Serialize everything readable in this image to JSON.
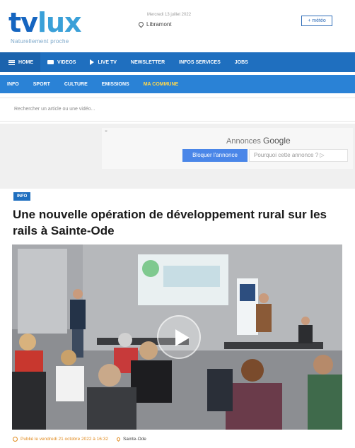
{
  "header": {
    "logo_tv": "tv",
    "logo_lux": "lux",
    "tagline": "Naturellement proche",
    "date": "Mercredi 13 juillet 2022",
    "location": "Libramont",
    "meteo_button": "+ météo"
  },
  "nav_primary": {
    "items": [
      {
        "label": "HOME",
        "icon": "menu-icon"
      },
      {
        "label": "VIDEOS",
        "icon": "video-icon"
      },
      {
        "label": "LIVE TV",
        "icon": "play-icon"
      },
      {
        "label": "NEWSLETTER"
      },
      {
        "label": "INFOS SERVICES"
      },
      {
        "label": "JOBS"
      }
    ]
  },
  "nav_secondary": {
    "items": [
      "INFO",
      "SPORT",
      "CULTURE",
      "EMISSIONS",
      "MA COMMUNE"
    ],
    "active_index": 4
  },
  "search": {
    "placeholder": "Rechercher un article ou une vidéo..."
  },
  "ad": {
    "close": "×",
    "title_prefix": "Annonces ",
    "title_brand": "Google",
    "block_button": "Bloquer l'annonce",
    "why_button": "Pourquoi cette annonce ? ▷"
  },
  "article": {
    "category": "INFO",
    "title": "Une nouvelle opération de développement rural sur les rails à Sainte-Ode",
    "published": "Publié le vendredi 21 octobre 2022 à 16:32",
    "place": "Sainte-Ode"
  },
  "colors": {
    "nav_primary": "#1f6fbf",
    "nav_secondary": "#2a82d6",
    "active_tab": "#ffd84d",
    "meta": "#e08a1e"
  }
}
